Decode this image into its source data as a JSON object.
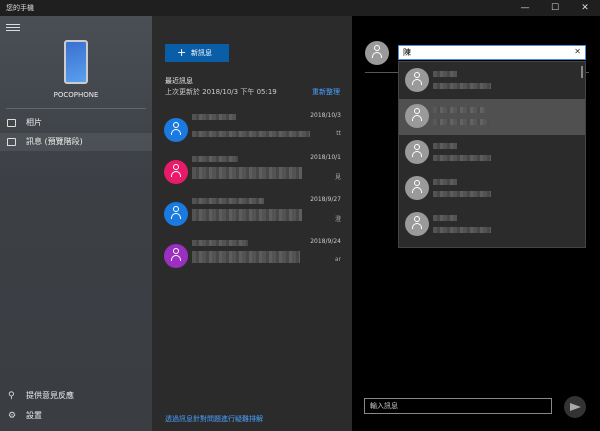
{
  "window": {
    "title": "您的手機",
    "min": "—",
    "max": "☐",
    "close": "✕"
  },
  "sidebar": {
    "phone_name": "POCOPHONE",
    "items": [
      {
        "label": "相片",
        "icon": "photo-icon"
      },
      {
        "label": "訊息 (預覽階段)",
        "icon": "message-icon"
      }
    ],
    "bottom": [
      {
        "label": "提供意見反應",
        "icon": "feedback-icon",
        "glyph": "⚲"
      },
      {
        "label": "設置",
        "icon": "gear-icon",
        "glyph": "⚙"
      }
    ]
  },
  "conversations": {
    "new_button": "新訊息",
    "recent_title": "最近訊息",
    "updated": "上次更新於 2018/10/3 下午 05:19",
    "refresh": "重新整理",
    "items": [
      {
        "date": "2018/10/3",
        "trail": "tt",
        "color": "#1a7ae0"
      },
      {
        "date": "2018/10/1",
        "trail": "見",
        "color": "#e81a6a"
      },
      {
        "date": "2018/9/27",
        "trail": "澄",
        "color": "#1a7ae0"
      },
      {
        "date": "2018/9/24",
        "trail": "ar",
        "color": "#9b30c0"
      }
    ],
    "footer_link": "透過訊息針對問題進行疑難排解"
  },
  "compose": {
    "to_value": "陳",
    "clear": "✕",
    "placeholder": "輸入訊息",
    "suggestions_highlighted": 1
  }
}
